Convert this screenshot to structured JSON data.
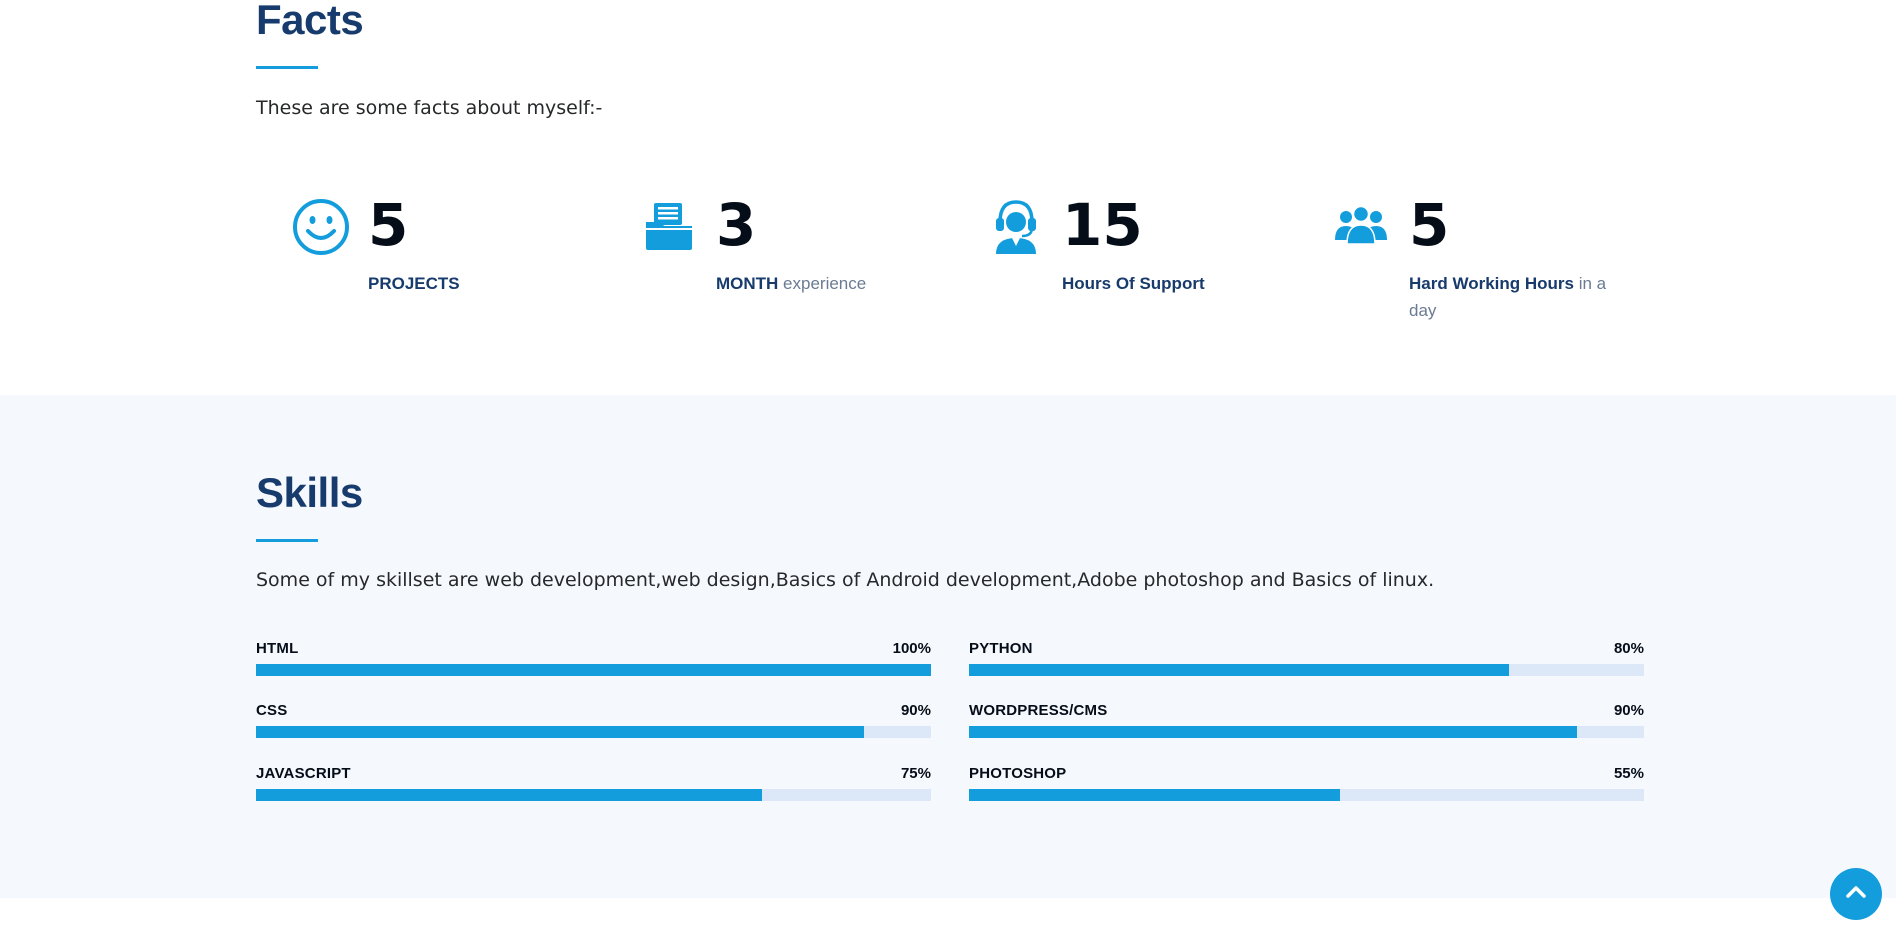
{
  "facts": {
    "title": "Facts",
    "intro": "These are some facts about myself:-",
    "items": [
      {
        "icon": "smiley-icon",
        "number": "5",
        "strong": "PROJECTS",
        "rest": ""
      },
      {
        "icon": "folder-icon",
        "number": "3",
        "strong": "MONTH",
        "rest": " experience"
      },
      {
        "icon": "headset-icon",
        "number": "15",
        "strong": "Hours Of Support",
        "rest": ""
      },
      {
        "icon": "people-icon",
        "number": "5",
        "strong": "Hard Working Hours",
        "rest": " in a day"
      }
    ]
  },
  "skills": {
    "title": "Skills",
    "intro": "Some of my skillset are web development,web design,Basics of Android development,Adobe photoshop and Basics of linux.",
    "items": [
      {
        "name": "HTML",
        "value": "100%",
        "level": 100
      },
      {
        "name": "PYTHON",
        "value": "80%",
        "level": 80
      },
      {
        "name": "CSS",
        "value": "90%",
        "level": 90
      },
      {
        "name": "WORDPRESS/CMS",
        "value": "90%",
        "level": 90
      },
      {
        "name": "JAVASCRIPT",
        "value": "75%",
        "level": 75
      },
      {
        "name": "PHOTOSHOP",
        "value": "55%",
        "level": 55
      }
    ]
  },
  "back_to_top": {
    "icon": "chevron-up-icon"
  },
  "colors": {
    "accent": "#149ddd",
    "heading": "#173b6c",
    "track": "#dce8f8",
    "skills_bg": "#f5f8fd"
  }
}
